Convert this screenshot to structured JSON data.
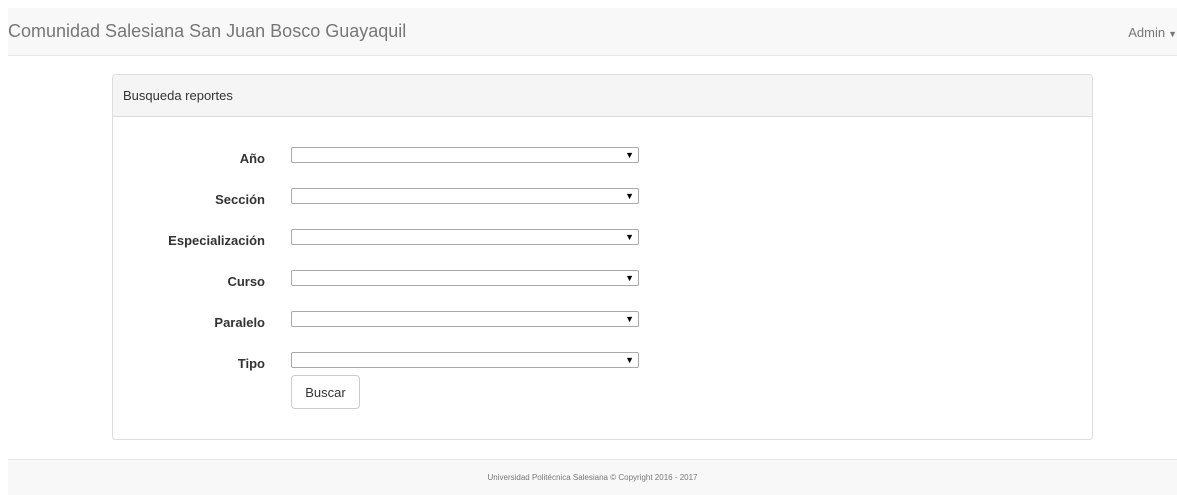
{
  "header": {
    "brand": "Comunidad Salesiana San Juan Bosco Guayaquil",
    "user_menu_label": "Admin",
    "user_menu_icon": "caret-down-icon"
  },
  "panel": {
    "title": "Busqueda reportes",
    "fields": [
      {
        "label": "Año",
        "selected": ""
      },
      {
        "label": "Sección",
        "selected": ""
      },
      {
        "label": "Especialización",
        "selected": ""
      },
      {
        "label": "Curso",
        "selected": ""
      },
      {
        "label": "Paralelo",
        "selected": ""
      },
      {
        "label": "Tipo",
        "selected": ""
      }
    ],
    "search_button_label": "Buscar"
  },
  "footer": {
    "text": "Universidad Politécnica Salesiana © Copyright 2016 - 2017"
  },
  "colors": {
    "navbar_bg": "#f8f8f8",
    "panel_heading_bg": "#f5f5f5",
    "border": "#dddddd",
    "muted_text": "#777777"
  }
}
